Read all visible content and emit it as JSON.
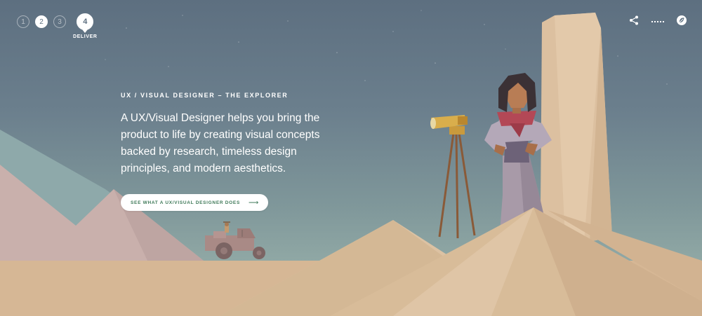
{
  "steps": {
    "items": [
      {
        "number": "1",
        "state": "inactive"
      },
      {
        "number": "2",
        "state": "done"
      },
      {
        "number": "3",
        "state": "inactive"
      },
      {
        "number": "4",
        "state": "active"
      }
    ],
    "active_label": "DELIVER"
  },
  "top_icons": [
    "share-icon",
    "more-dots-icon",
    "leaf-logo-icon"
  ],
  "hero": {
    "eyebrow": "UX / VISUAL DESIGNER – THE EXPLORER",
    "body": "A UX/Visual Designer helps you bring the product to life by creating visual concepts backed by research, timeless design principles, and modern aesthetics.",
    "cta_label": "SEE WHAT A UX/VISUAL DESIGNER DOES",
    "cta_arrow": "⟶"
  },
  "colors": {
    "sky_top": "#5d6f80",
    "sky_bottom": "#9bb2ab",
    "sand": "#d7b896",
    "sand_dark": "#c9a683",
    "pink_mountain": "#c9b0ac",
    "rock_pillar": "#dcc0a0",
    "cta_text": "#3f7a59"
  }
}
